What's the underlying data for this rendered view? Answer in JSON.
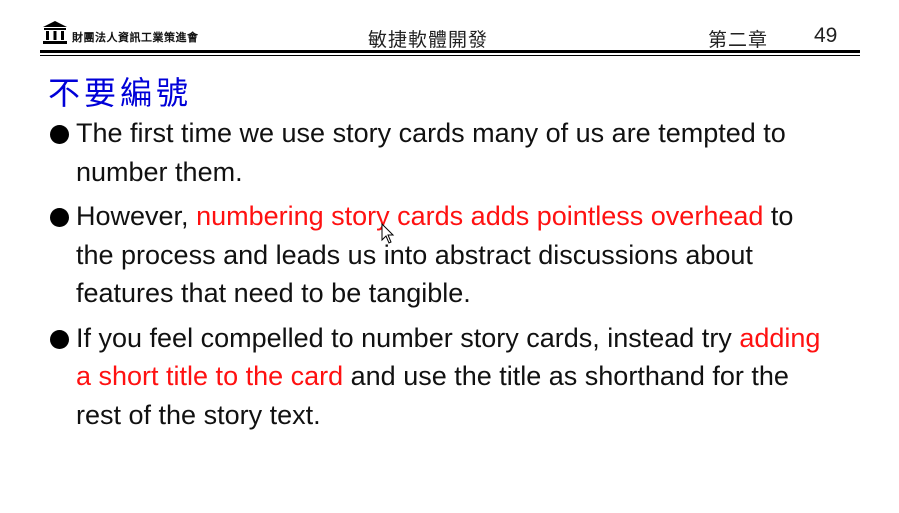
{
  "header": {
    "org_name": "財團法人資訊工業策進會",
    "course_title": "敏捷軟體開發",
    "chapter": "第二章",
    "page_number": "49"
  },
  "slide": {
    "title": "不要編號",
    "bullets": [
      {
        "parts": [
          {
            "text": "The first time we use story cards many of us are tempted to number them.",
            "highlight": false
          }
        ]
      },
      {
        "parts": [
          {
            "text": "However, ",
            "highlight": false
          },
          {
            "text": "numbering story cards adds pointless overhead",
            "highlight": true
          },
          {
            "text": " to the process and leads us into abstract discussions about features that need to be tangible.",
            "highlight": false
          }
        ]
      },
      {
        "parts": [
          {
            "text": "If you feel compelled to number story cards, instead try ",
            "highlight": false
          },
          {
            "text": "adding a short title to the card",
            "highlight": true
          },
          {
            "text": " and use the title as shorthand for the rest of the story text.",
            "highlight": false
          }
        ]
      }
    ]
  },
  "colors": {
    "title": "#0000d8",
    "highlight": "#ff1111",
    "body_text": "#111111"
  },
  "icons": {
    "logo": "institution-building-icon",
    "cursor": "mouse-pointer-icon"
  }
}
